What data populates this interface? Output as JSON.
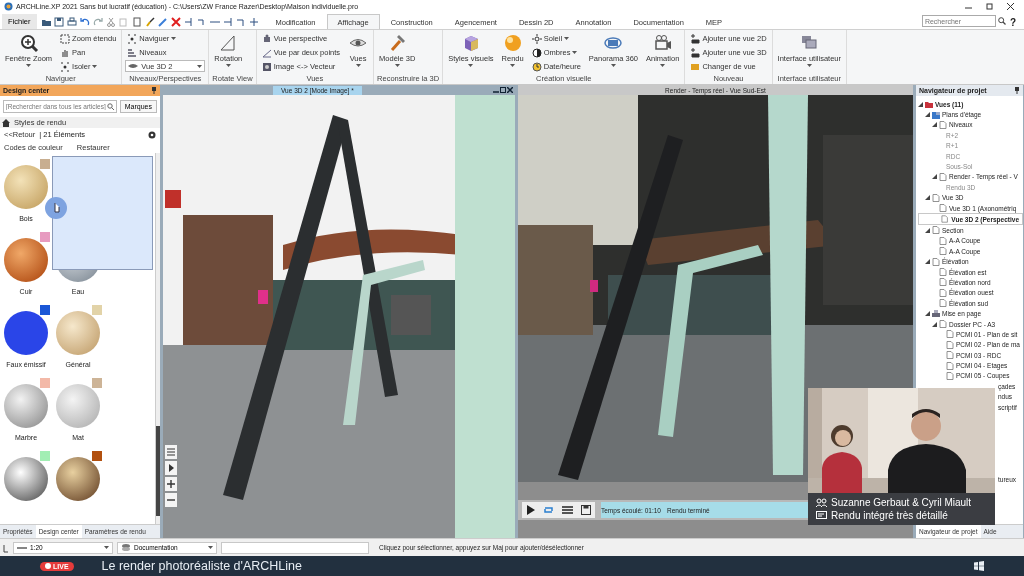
{
  "window": {
    "title": "ARCHLine.XP 2021  Sans but lucratif (éducation) - C:\\Users\\ZW France Razer\\Desktop\\Maison individuelle.pro"
  },
  "menu": {
    "file": "Fichier",
    "tabs": [
      {
        "label": "Modification",
        "selected": false
      },
      {
        "label": "Affichage",
        "selected": true
      },
      {
        "label": "Construction",
        "selected": false
      },
      {
        "label": "Agencement",
        "selected": false
      },
      {
        "label": "Dessin 2D",
        "selected": false
      },
      {
        "label": "Annotation",
        "selected": false
      },
      {
        "label": "Documentation",
        "selected": false
      },
      {
        "label": "MEP",
        "selected": false
      }
    ],
    "search": {
      "placeholder": "Rechercher"
    },
    "help": "?"
  },
  "ribbon": {
    "groups": [
      {
        "label": "Naviguer",
        "items": [
          {
            "label": "Fenêtre Zoom",
            "kind": "large",
            "dropdown": true
          },
          {
            "label": "Zoom étendu",
            "kind": "small",
            "dropdown": false
          },
          {
            "label": "Pan",
            "kind": "small",
            "dropdown": false
          },
          {
            "label": "Isoler",
            "kind": "small",
            "dropdown": true
          }
        ]
      },
      {
        "label": "Niveaux/Perspectives",
        "items": [
          {
            "label": "Naviguer",
            "kind": "small",
            "dropdown": true
          },
          {
            "label": "Niveaux",
            "kind": "small",
            "dropdown": false
          },
          {
            "label": "Vue 3D 2",
            "kind": "select",
            "dropdown": true
          }
        ]
      },
      {
        "label": "Rotate View",
        "items": [
          {
            "label": "Rotation",
            "kind": "large",
            "dropdown": true
          }
        ]
      },
      {
        "label": "Vues",
        "items": [
          {
            "label": "Vue perspective",
            "kind": "small",
            "dropdown": false
          },
          {
            "label": "Vue par deux points",
            "kind": "small",
            "dropdown": false
          },
          {
            "label": "Image <-> Vecteur",
            "kind": "small",
            "dropdown": false
          },
          {
            "label": "Vues",
            "kind": "large",
            "dropdown": true
          }
        ]
      },
      {
        "label": "Reconstruire la 3D",
        "items": [
          {
            "label": "Modèle 3D",
            "kind": "large",
            "dropdown": true
          }
        ]
      },
      {
        "label": "Création visuelle",
        "items": [
          {
            "label": "Styles visuels",
            "kind": "large",
            "dropdown": true
          },
          {
            "label": "Rendu",
            "kind": "large",
            "dropdown": true
          },
          {
            "label": "Soleil",
            "kind": "small",
            "dropdown": true
          },
          {
            "label": "Ombres",
            "kind": "small",
            "dropdown": true
          },
          {
            "label": "Date/heure",
            "kind": "small",
            "dropdown": false
          },
          {
            "label": "Panorama 360",
            "kind": "large",
            "dropdown": true
          },
          {
            "label": "Animation",
            "kind": "large",
            "dropdown": true
          }
        ]
      },
      {
        "label": "Nouveau",
        "items": [
          {
            "label": "Ajouter une vue 2D",
            "kind": "small",
            "dropdown": false
          },
          {
            "label": "Ajouter une vue 3D",
            "kind": "small",
            "dropdown": false
          },
          {
            "label": "Changer de vue",
            "kind": "small",
            "dropdown": false
          }
        ]
      },
      {
        "label": "Interface utilisateur",
        "items": [
          {
            "label": "Interface utilisateur",
            "kind": "large",
            "dropdown": true
          }
        ]
      }
    ]
  },
  "design_center": {
    "title": "Design center",
    "search": {
      "placeholder": "[Rechercher dans tous les articles]"
    },
    "brands_button": "Marques",
    "breadcrumb": "Styles de rendu",
    "back": "<<Retour",
    "count": "| 21 Éléments",
    "actions": [
      "Codes de couleur",
      "Restaurer"
    ],
    "materials": [
      {
        "label": "Bois",
        "kind": "wood",
        "color": "#c8ae90"
      },
      {
        "label": "Cuir",
        "kind": "leather",
        "color": "#e79bc0"
      },
      {
        "label": "Eau",
        "kind": "water"
      },
      {
        "label": "Faux émissif",
        "kind": "emissive",
        "color": "#1a56d6"
      },
      {
        "label": "Général",
        "kind": "general",
        "color": "#e2d3a8"
      },
      {
        "label": "Marbre",
        "kind": "marble",
        "color": "#f3b9a8"
      },
      {
        "label": "Mat",
        "kind": "matte",
        "color": "#cdb497"
      },
      {
        "kind": "mirror",
        "color": "#a2eeb4"
      },
      {
        "kind": "textured",
        "color": "#b2500f"
      }
    ],
    "tabs": [
      {
        "label": "Propriétés",
        "selected": false
      },
      {
        "label": "Design center",
        "selected": true
      },
      {
        "label": "Paramètres de rendu",
        "selected": false
      }
    ]
  },
  "viewports": [
    {
      "title": "Vue 3D 2 [Mode Image] *",
      "kind": "model"
    },
    {
      "title": "Render - Temps réel - Vue Sud-Est",
      "kind": "render",
      "elapsed": "Temps écoulé: 01:10",
      "state": "Rendu terminé"
    }
  ],
  "navigator": {
    "title": "Navigateur de projet",
    "tree": [
      {
        "label": "Vues (11)",
        "kind": "views",
        "expanded": true,
        "selected": false,
        "cut": false,
        "children": [
          {
            "label": "Plans d'étage",
            "kind": "plans",
            "expanded": true,
            "selected": false,
            "children": [
              {
                "label": "Niveaux",
                "kind": "page",
                "expanded": true,
                "selected": false,
                "children": [
                  {
                    "label": "R+2",
                    "kind": "level",
                    "selected": false
                  },
                  {
                    "label": "R+1",
                    "kind": "level",
                    "selected": false
                  },
                  {
                    "label": "RDC",
                    "kind": "level",
                    "selected": false
                  },
                  {
                    "label": "Sous-Sol",
                    "kind": "level",
                    "selected": false
                  }
                ]
              },
              {
                "label": "Render - Temps réel - V",
                "kind": "page",
                "expanded": true,
                "selected": false,
                "children": [
                  {
                    "label": "Rendu 3D",
                    "kind": "level",
                    "selected": false
                  }
                ]
              }
            ]
          },
          {
            "label": "Vue 3D",
            "kind": "page",
            "expanded": true,
            "selected": false,
            "children": [
              {
                "label": "Vue 3D 1 (Axonométriq",
                "kind": "page",
                "selected": false
              },
              {
                "label": "Vue 3D 2 (Perspective",
                "kind": "page",
                "selected": true
              }
            ]
          },
          {
            "label": "Section",
            "kind": "page",
            "expanded": true,
            "selected": false,
            "children": [
              {
                "label": "A-A Coupe",
                "kind": "page",
                "selected": false
              },
              {
                "label": "A-A Coupe",
                "kind": "page",
                "selected": false
              }
            ]
          },
          {
            "label": "Élévation",
            "kind": "page",
            "expanded": true,
            "selected": false,
            "children": [
              {
                "label": "Élévation est",
                "kind": "page",
                "selected": false
              },
              {
                "label": "Élévation nord",
                "kind": "page",
                "selected": false
              },
              {
                "label": "Élévation ouest",
                "kind": "page",
                "selected": false
              },
              {
                "label": "Élévation sud",
                "kind": "page",
                "selected": false
              }
            ]
          },
          {
            "label": "Mise en page",
            "kind": "layout",
            "expanded": true,
            "selected": false,
            "children": [
              {
                "label": "Dossier PC - A3",
                "kind": "page",
                "expanded": true,
                "selected": false,
                "children": [
                  {
                    "label": "PCMI 01 - Plan de sit",
                    "kind": "page",
                    "selected": false,
                    "cut": false
                  },
                  {
                    "label": "PCMI 02 - Plan de ma",
                    "kind": "page",
                    "selected": false,
                    "cut": false
                  },
                  {
                    "label": "PCMI 03 - RDC",
                    "kind": "page",
                    "selected": false,
                    "cut": false
                  },
                  {
                    "label": "PCMI 04 - Etages",
                    "kind": "page",
                    "selected": false,
                    "cut": false
                  },
                  {
                    "label": "PCMI 05 - Coupes",
                    "kind": "page",
                    "selected": false,
                    "cut": false
                  },
                  {
                    "label": "çades",
                    "kind": "page",
                    "selected": false,
                    "cut": true
                  },
                  {
                    "label": "ndus",
                    "kind": "page",
                    "selected": false,
                    "cut": true
                  },
                  {
                    "label": "scriptif",
                    "kind": "page",
                    "selected": false,
                    "cut": true
                  }
                ]
              }
            ]
          }
        ]
      },
      {
        "label": "tureux",
        "kind": "page",
        "selected": false,
        "cut": true
      }
    ],
    "tabs": [
      {
        "label": "Navigateur de projet",
        "selected": true
      },
      {
        "label": "Aide",
        "selected": false
      }
    ]
  },
  "webcam": {
    "names": "Suzanne Gerbaut & Cyril Miault",
    "caption": "Rendu intégré très détaillé"
  },
  "status_bar": {
    "scale": "1:20",
    "layer": "Documentation",
    "message": "Cliquez pour sélectionner, appuyez sur Maj pour ajouter/désélectionner"
  },
  "banner": {
    "badge": "LIVE",
    "title": "Le render photoréaliste d'ARCHLine"
  }
}
